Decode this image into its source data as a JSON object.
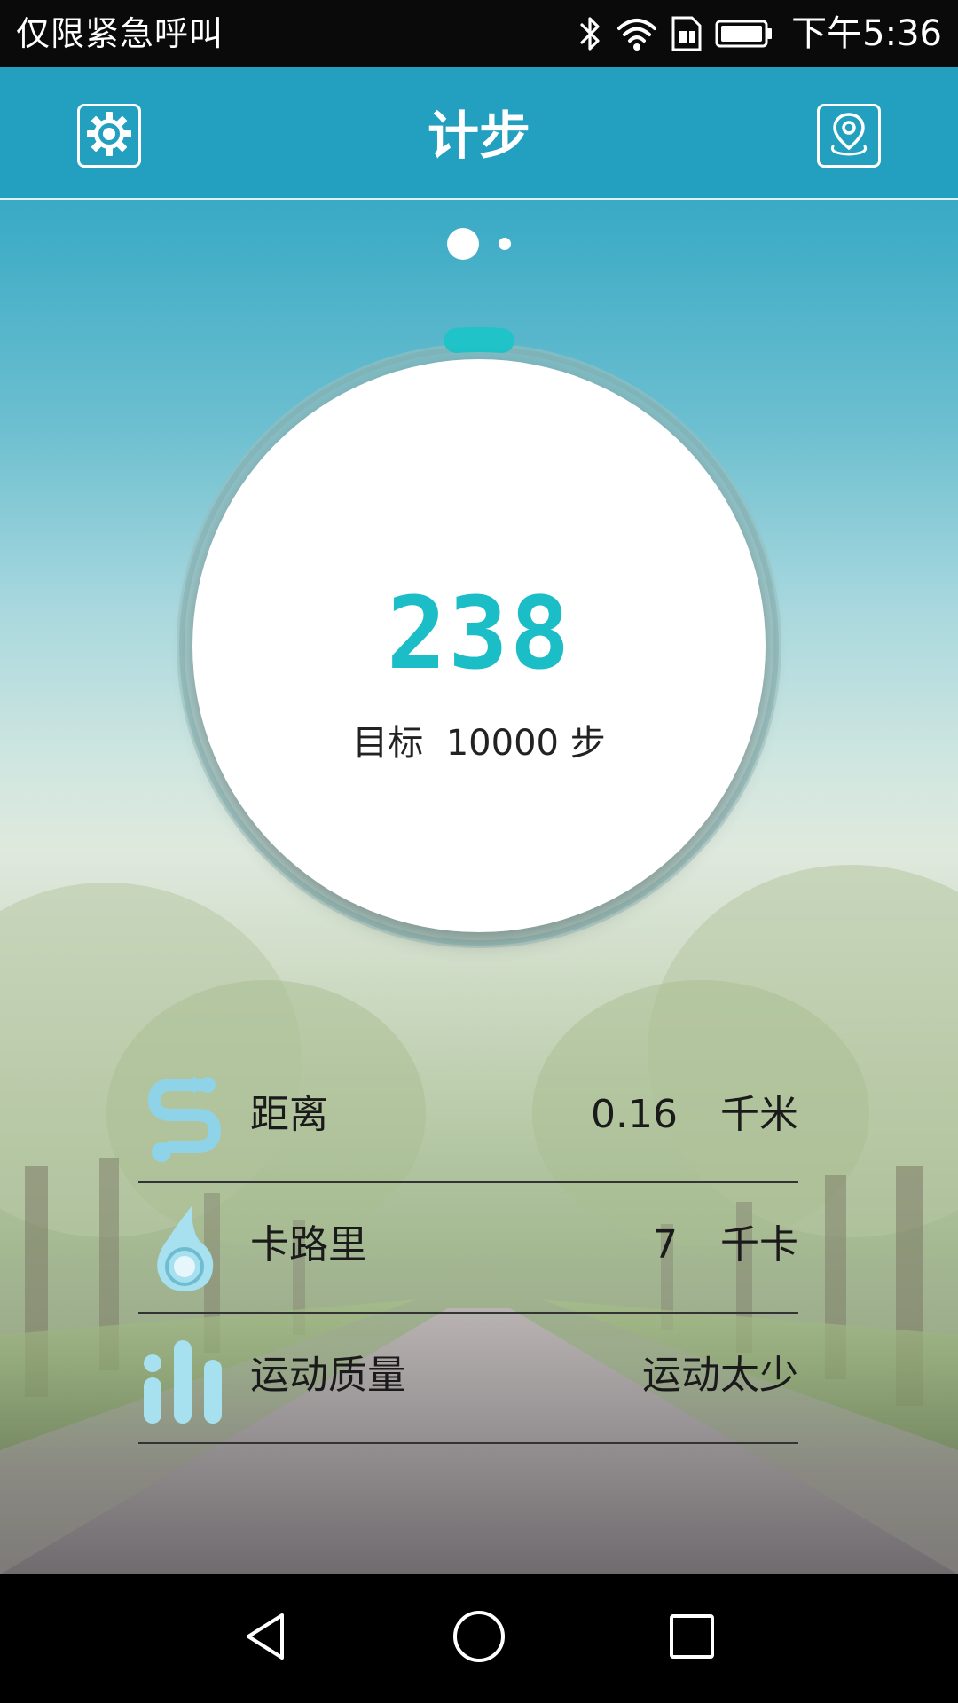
{
  "status_bar": {
    "carrier_text": "仅限紧急呼叫",
    "time": "下午5:36",
    "icons": [
      "bluetooth-icon",
      "wifi-icon",
      "sim-icon",
      "battery-icon"
    ]
  },
  "header": {
    "title": "计步",
    "left_icon": "settings-gear-icon",
    "right_icon": "location-pin-icon"
  },
  "pager": {
    "page_count": 2,
    "active_page": 1
  },
  "steps": {
    "count": "238",
    "goal_label": "目标",
    "goal_value": "10000",
    "goal_unit": "步",
    "progress_fraction": 0.0238
  },
  "stats": [
    {
      "icon": "distance-route-icon",
      "label": "距离",
      "value": "0.16",
      "unit": "千米"
    },
    {
      "icon": "calorie-flame-icon",
      "label": "卡路里",
      "value": "7",
      "unit": "千卡"
    },
    {
      "icon": "activity-bars-icon",
      "label": "运动质量",
      "value": "运动太少"
    }
  ],
  "nav_bar": {
    "icons": [
      "back-triangle-icon",
      "home-circle-icon",
      "recent-square-icon"
    ]
  },
  "colors": {
    "header_bg": "#23a0bf",
    "accent": "#1bbdc6",
    "stat_icon": "#8fd3e8"
  }
}
